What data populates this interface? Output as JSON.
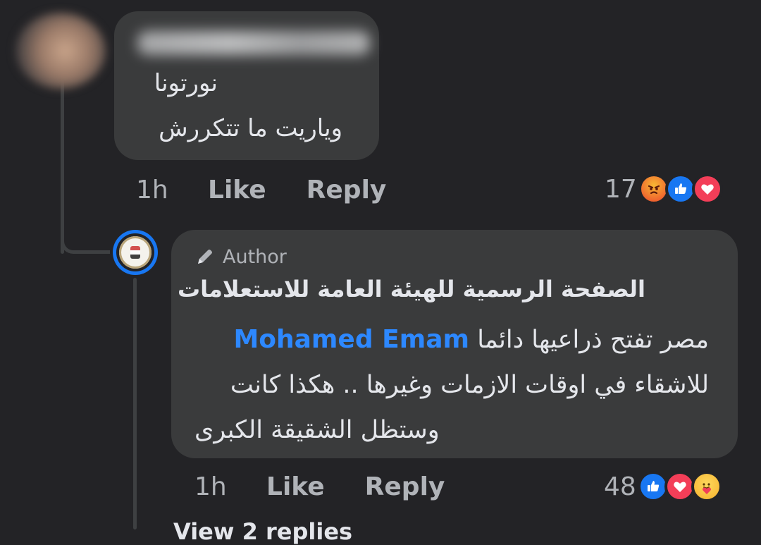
{
  "comment": {
    "author_name": "",
    "lines": [
      "نورتونا",
      "وياريت ما تتكررش"
    ],
    "time": "1h",
    "like_label": "Like",
    "reply_label": "Reply",
    "reaction_count": "17",
    "reactions": [
      "angry-icon",
      "like-icon",
      "love-icon"
    ]
  },
  "reply": {
    "badge": "Author",
    "page_name": "الصفحة الرسمية للهيئة العامة للاستعلامات",
    "mention": "Mohamed Emam",
    "body_line1": "مصر تفتح ذراعيها دائما",
    "body_line2": "للاشقاء في اوقات الازمات وغيرها .. هكذا كانت",
    "body_line3": "وستظل الشقيقة الكبرى",
    "time": "1h",
    "like_label": "Like",
    "reply_label": "Reply",
    "reaction_count": "48",
    "reactions": [
      "like-icon",
      "love-icon",
      "care-icon"
    ]
  },
  "footer": {
    "view_more": "View 2 replies"
  },
  "colors": {
    "background": "#232326",
    "bubble": "#3a3b3c",
    "mention": "#2d88ff",
    "muted": "#b0b3b8",
    "like": "#1877f2",
    "love": "#f33e58"
  }
}
